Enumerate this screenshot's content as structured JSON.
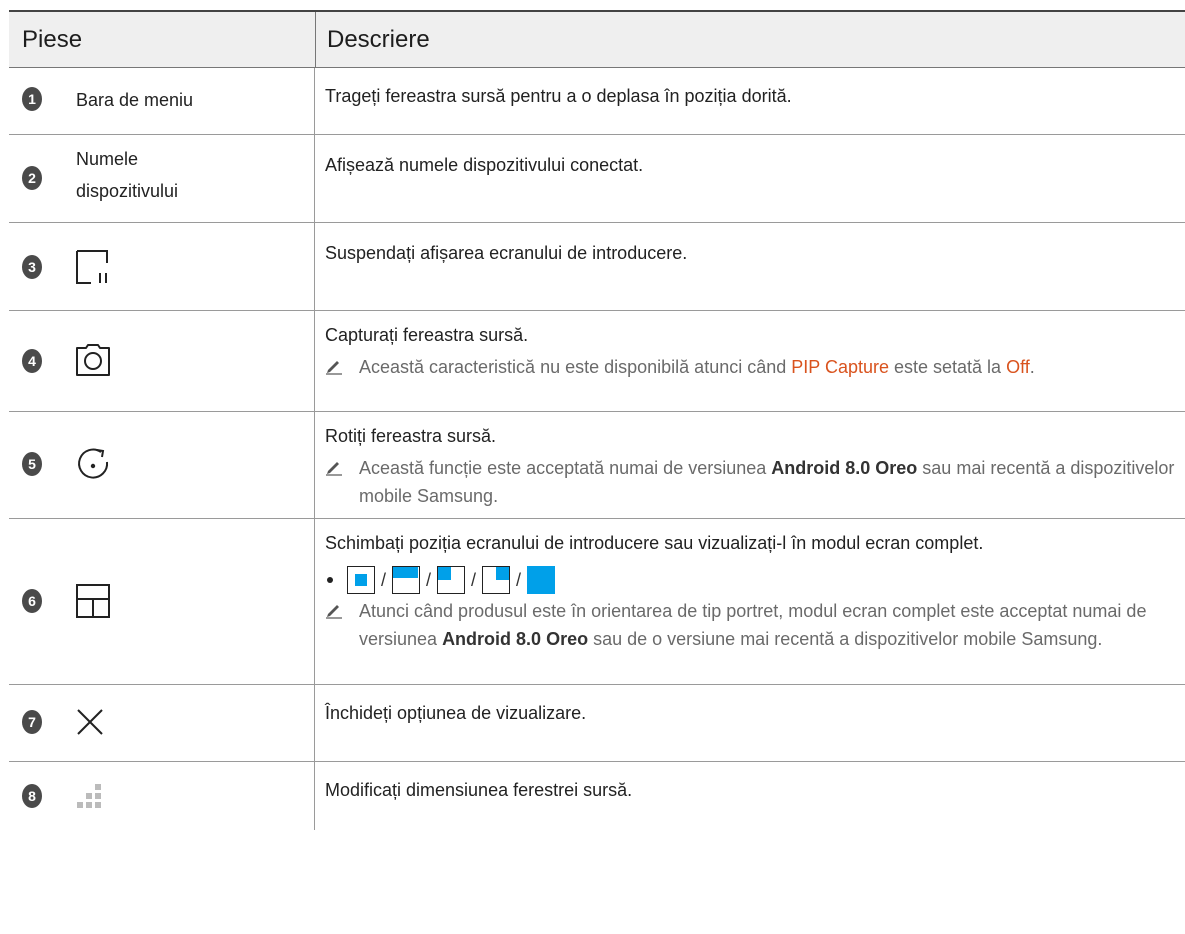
{
  "header": {
    "col_parts": "Piese",
    "col_description": "Descriere"
  },
  "rows": [
    {
      "num": "1",
      "label": "Bara de meniu",
      "icon": null,
      "desc": "Trageți fereastra sursă pentru a o deplasa în poziția dorită."
    },
    {
      "num": "2",
      "label_line1": "Numele",
      "label_line2": "dispozitivului",
      "icon": null,
      "desc": "Afișează numele dispozitivului conectat."
    },
    {
      "num": "3",
      "icon": "pause-screen-icon",
      "desc": "Suspendați afișarea ecranului de introducere."
    },
    {
      "num": "4",
      "icon": "camera-icon",
      "desc": "Capturați fereastra sursă.",
      "note": {
        "before": "Această caracteristică nu este disponibilă atunci când ",
        "hl1": "PIP Capture",
        "middle": " este setată la ",
        "hl2": "Off",
        "after": "."
      }
    },
    {
      "num": "5",
      "icon": "rotate-icon",
      "desc": "Rotiți fereastra sursă.",
      "note": {
        "before": "Această funcție este acceptată numai de versiunea ",
        "bold": "Android 8.0 Oreo",
        "after": " sau mai recentă a dispozitivelor mobile Samsung."
      }
    },
    {
      "num": "6",
      "icon": "layout-icon",
      "desc": "Schimbați poziția ecranului de introducere sau vizualizați-l în modul ecran complet.",
      "bullet_icons": [
        "position-center-icon",
        "position-top-icon",
        "position-top-left-icon",
        "position-top-right-icon",
        "position-fullscreen-icon"
      ],
      "separator": "/",
      "note": {
        "before": "Atunci când produsul este în orientarea de tip portret, modul ecran complet este acceptat numai de versiunea ",
        "bold": "Android 8.0 Oreo",
        "after": " sau de o versiune mai recentă a dispozitivelor mobile Samsung."
      }
    },
    {
      "num": "7",
      "icon": "close-icon",
      "desc": "Închideți opțiunea de vizualizare."
    },
    {
      "num": "8",
      "icon": "resize-handle-icon",
      "desc": "Modificați dimensiunea ferestrei sursă."
    }
  ],
  "colors": {
    "accent": "#00a0e9",
    "highlight": "#d9531e",
    "badge": "#4a4a4a"
  }
}
